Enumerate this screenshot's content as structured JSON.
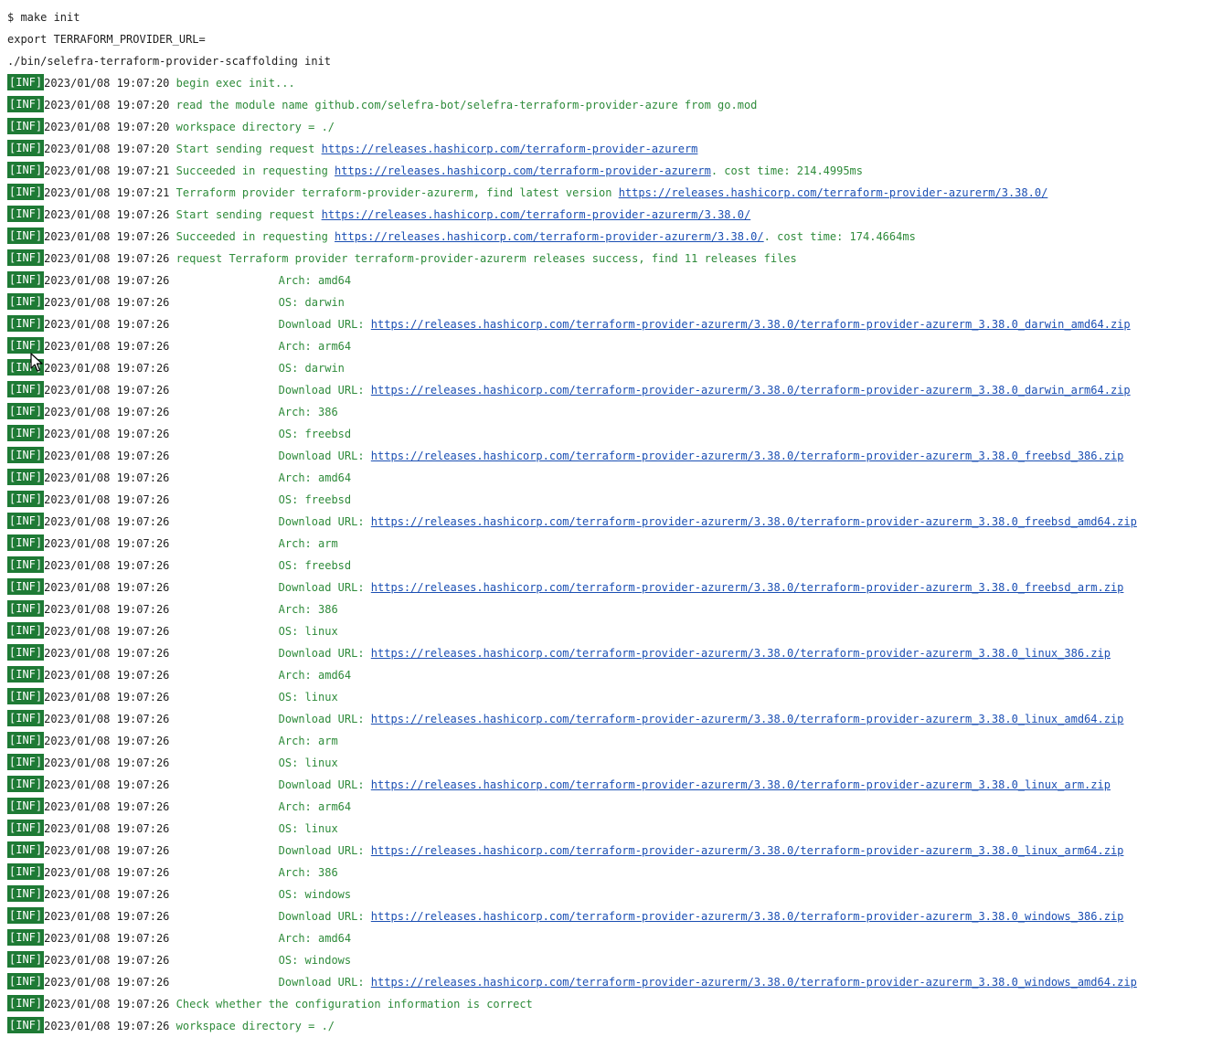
{
  "commands": [
    "$ make init",
    "export TERRAFORM_PROVIDER_URL=",
    "./bin/selefra-terraform-provider-scaffolding init"
  ],
  "log_tag": "[INF]",
  "logs": [
    {
      "ts": "2023/01/08 19:07:20",
      "indent": false,
      "text": "begin exec init...",
      "link": "",
      "suffix": ""
    },
    {
      "ts": "2023/01/08 19:07:20",
      "indent": false,
      "text": "read the module name github.com/selefra-bot/selefra-terraform-provider-azure from go.mod",
      "link": "",
      "suffix": ""
    },
    {
      "ts": "2023/01/08 19:07:20",
      "indent": false,
      "text": "workspace directory = ./",
      "link": "",
      "suffix": ""
    },
    {
      "ts": "2023/01/08 19:07:20",
      "indent": false,
      "text": "Start sending request ",
      "link": "https://releases.hashicorp.com/terraform-provider-azurerm",
      "suffix": ""
    },
    {
      "ts": "2023/01/08 19:07:21",
      "indent": false,
      "text": "Succeeded in requesting ",
      "link": "https://releases.hashicorp.com/terraform-provider-azurerm",
      "suffix": ". cost time: 214.4995ms"
    },
    {
      "ts": "2023/01/08 19:07:21",
      "indent": false,
      "text": "Terraform provider terraform-provider-azurerm, find latest version ",
      "link": "https://releases.hashicorp.com/terraform-provider-azurerm/3.38.0/",
      "suffix": ""
    },
    {
      "ts": "2023/01/08 19:07:26",
      "indent": false,
      "text": "Start sending request ",
      "link": "https://releases.hashicorp.com/terraform-provider-azurerm/3.38.0/",
      "suffix": ""
    },
    {
      "ts": "2023/01/08 19:07:26",
      "indent": false,
      "text": "Succeeded in requesting ",
      "link": "https://releases.hashicorp.com/terraform-provider-azurerm/3.38.0/",
      "suffix": ". cost time: 174.4664ms"
    },
    {
      "ts": "2023/01/08 19:07:26",
      "indent": false,
      "text": "request Terraform provider terraform-provider-azurerm releases success, find 11 releases files",
      "link": "",
      "suffix": ""
    },
    {
      "ts": "2023/01/08 19:07:26",
      "indent": true,
      "text": "Arch: amd64",
      "link": "",
      "suffix": ""
    },
    {
      "ts": "2023/01/08 19:07:26",
      "indent": true,
      "text": "OS: darwin",
      "link": "",
      "suffix": ""
    },
    {
      "ts": "2023/01/08 19:07:26",
      "indent": true,
      "text": "Download URL: ",
      "link": "https://releases.hashicorp.com/terraform-provider-azurerm/3.38.0/terraform-provider-azurerm_3.38.0_darwin_amd64.zip",
      "suffix": ""
    },
    {
      "ts": "2023/01/08 19:07:26",
      "indent": true,
      "text": "Arch: arm64",
      "link": "",
      "suffix": ""
    },
    {
      "ts": "2023/01/08 19:07:26",
      "indent": true,
      "text": "OS: darwin",
      "link": "",
      "suffix": ""
    },
    {
      "ts": "2023/01/08 19:07:26",
      "indent": true,
      "text": "Download URL: ",
      "link": "https://releases.hashicorp.com/terraform-provider-azurerm/3.38.0/terraform-provider-azurerm_3.38.0_darwin_arm64.zip",
      "suffix": ""
    },
    {
      "ts": "2023/01/08 19:07:26",
      "indent": true,
      "text": "Arch: 386",
      "link": "",
      "suffix": ""
    },
    {
      "ts": "2023/01/08 19:07:26",
      "indent": true,
      "text": "OS: freebsd",
      "link": "",
      "suffix": ""
    },
    {
      "ts": "2023/01/08 19:07:26",
      "indent": true,
      "text": "Download URL: ",
      "link": "https://releases.hashicorp.com/terraform-provider-azurerm/3.38.0/terraform-provider-azurerm_3.38.0_freebsd_386.zip",
      "suffix": ""
    },
    {
      "ts": "2023/01/08 19:07:26",
      "indent": true,
      "text": "Arch: amd64",
      "link": "",
      "suffix": ""
    },
    {
      "ts": "2023/01/08 19:07:26",
      "indent": true,
      "text": "OS: freebsd",
      "link": "",
      "suffix": ""
    },
    {
      "ts": "2023/01/08 19:07:26",
      "indent": true,
      "text": "Download URL: ",
      "link": "https://releases.hashicorp.com/terraform-provider-azurerm/3.38.0/terraform-provider-azurerm_3.38.0_freebsd_amd64.zip",
      "suffix": ""
    },
    {
      "ts": "2023/01/08 19:07:26",
      "indent": true,
      "text": "Arch: arm",
      "link": "",
      "suffix": ""
    },
    {
      "ts": "2023/01/08 19:07:26",
      "indent": true,
      "text": "OS: freebsd",
      "link": "",
      "suffix": ""
    },
    {
      "ts": "2023/01/08 19:07:26",
      "indent": true,
      "text": "Download URL: ",
      "link": "https://releases.hashicorp.com/terraform-provider-azurerm/3.38.0/terraform-provider-azurerm_3.38.0_freebsd_arm.zip",
      "suffix": ""
    },
    {
      "ts": "2023/01/08 19:07:26",
      "indent": true,
      "text": "Arch: 386",
      "link": "",
      "suffix": ""
    },
    {
      "ts": "2023/01/08 19:07:26",
      "indent": true,
      "text": "OS: linux",
      "link": "",
      "suffix": ""
    },
    {
      "ts": "2023/01/08 19:07:26",
      "indent": true,
      "text": "Download URL: ",
      "link": "https://releases.hashicorp.com/terraform-provider-azurerm/3.38.0/terraform-provider-azurerm_3.38.0_linux_386.zip",
      "suffix": ""
    },
    {
      "ts": "2023/01/08 19:07:26",
      "indent": true,
      "text": "Arch: amd64",
      "link": "",
      "suffix": ""
    },
    {
      "ts": "2023/01/08 19:07:26",
      "indent": true,
      "text": "OS: linux",
      "link": "",
      "suffix": ""
    },
    {
      "ts": "2023/01/08 19:07:26",
      "indent": true,
      "text": "Download URL: ",
      "link": "https://releases.hashicorp.com/terraform-provider-azurerm/3.38.0/terraform-provider-azurerm_3.38.0_linux_amd64.zip",
      "suffix": ""
    },
    {
      "ts": "2023/01/08 19:07:26",
      "indent": true,
      "text": "Arch: arm",
      "link": "",
      "suffix": ""
    },
    {
      "ts": "2023/01/08 19:07:26",
      "indent": true,
      "text": "OS: linux",
      "link": "",
      "suffix": ""
    },
    {
      "ts": "2023/01/08 19:07:26",
      "indent": true,
      "text": "Download URL: ",
      "link": "https://releases.hashicorp.com/terraform-provider-azurerm/3.38.0/terraform-provider-azurerm_3.38.0_linux_arm.zip",
      "suffix": ""
    },
    {
      "ts": "2023/01/08 19:07:26",
      "indent": true,
      "text": "Arch: arm64",
      "link": "",
      "suffix": ""
    },
    {
      "ts": "2023/01/08 19:07:26",
      "indent": true,
      "text": "OS: linux",
      "link": "",
      "suffix": ""
    },
    {
      "ts": "2023/01/08 19:07:26",
      "indent": true,
      "text": "Download URL: ",
      "link": "https://releases.hashicorp.com/terraform-provider-azurerm/3.38.0/terraform-provider-azurerm_3.38.0_linux_arm64.zip",
      "suffix": ""
    },
    {
      "ts": "2023/01/08 19:07:26",
      "indent": true,
      "text": "Arch: 386",
      "link": "",
      "suffix": ""
    },
    {
      "ts": "2023/01/08 19:07:26",
      "indent": true,
      "text": "OS: windows",
      "link": "",
      "suffix": ""
    },
    {
      "ts": "2023/01/08 19:07:26",
      "indent": true,
      "text": "Download URL: ",
      "link": "https://releases.hashicorp.com/terraform-provider-azurerm/3.38.0/terraform-provider-azurerm_3.38.0_windows_386.zip",
      "suffix": ""
    },
    {
      "ts": "2023/01/08 19:07:26",
      "indent": true,
      "text": "Arch: amd64",
      "link": "",
      "suffix": ""
    },
    {
      "ts": "2023/01/08 19:07:26",
      "indent": true,
      "text": "OS: windows",
      "link": "",
      "suffix": ""
    },
    {
      "ts": "2023/01/08 19:07:26",
      "indent": true,
      "text": "Download URL: ",
      "link": "https://releases.hashicorp.com/terraform-provider-azurerm/3.38.0/terraform-provider-azurerm_3.38.0_windows_amd64.zip",
      "suffix": ""
    },
    {
      "ts": "2023/01/08 19:07:26",
      "indent": false,
      "text": "Check whether the configuration information is correct",
      "link": "",
      "suffix": ""
    },
    {
      "ts": "2023/01/08 19:07:26",
      "indent": false,
      "text": "workspace directory = ./",
      "link": "",
      "suffix": ""
    }
  ],
  "colors": {
    "tag_bg": "#1e7a35",
    "message": "#2e8b3a",
    "link": "#1b4fb3"
  },
  "icons": {
    "cursor": "mouse-pointer-icon"
  }
}
